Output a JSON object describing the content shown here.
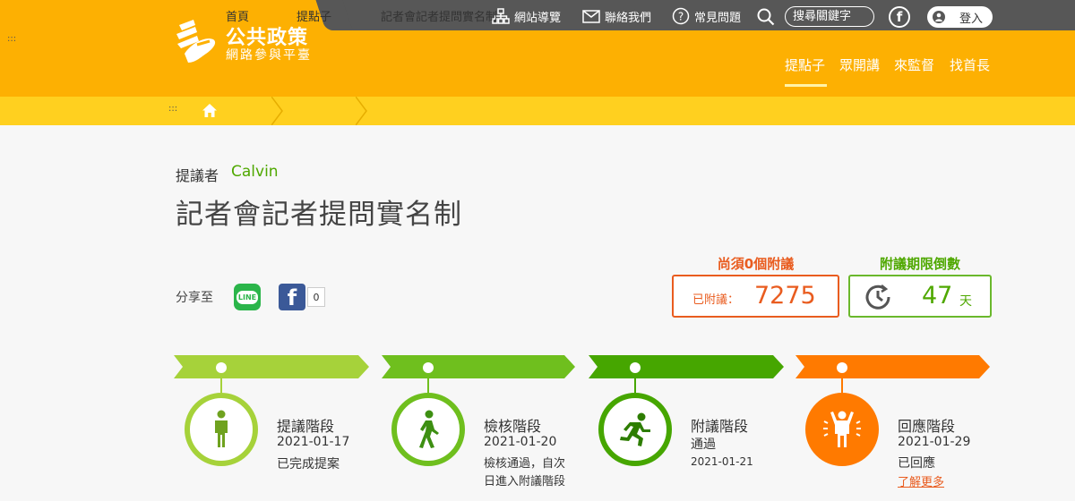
{
  "header": {
    "logo_title": "公共政策",
    "logo_subtitle": "網路參與平臺",
    "top_links": {
      "sitemap": "網站導覽",
      "contact": "聯絡我們",
      "faq": "常見問題"
    },
    "search_placeholder": "搜尋關鍵字",
    "facebook_glyph": "f",
    "login": "登入",
    "nav": [
      "提點子",
      "眾開講",
      "來監督",
      "找首長"
    ]
  },
  "breadcrumb": {
    "home": "首頁",
    "section": "提點子",
    "current": "記者會記者提問實名制"
  },
  "proposal": {
    "proposer_label": "提議者",
    "proposer_name": "Calvin",
    "title": "記者會記者提問實名制"
  },
  "share": {
    "label": "分享至",
    "line_text": "LINE",
    "facebook_glyph": "f",
    "facebook_count": "0"
  },
  "support": {
    "need_label": "尚須0個附議",
    "count_label": "已附議：",
    "count_value": "7275"
  },
  "countdown": {
    "label": "附議期限倒數",
    "value": "47",
    "unit": "天"
  },
  "stages": [
    {
      "name": "提議階段",
      "date": "2021-01-17",
      "note": "已完成提案",
      "color": "#a6d23a"
    },
    {
      "name": "檢核階段",
      "date": "2021-01-20",
      "note_lines": [
        "檢核通過，自次",
        "日進入附議階段"
      ],
      "color": "#6fbf1e"
    },
    {
      "name": "附議階段",
      "status": "通過",
      "date": "2021-01-21",
      "color": "#46a600"
    },
    {
      "name": "回應階段",
      "date": "2021-01-29",
      "note": "已回應",
      "link": "了解更多",
      "color": "#ff7a00"
    }
  ],
  "colors": {
    "header_bg": "#fdb002",
    "topbar_bg": "#575757",
    "breadcrumb_bg": "#ffd01f",
    "support_accent": "#e95c1f",
    "countdown_accent": "#4fa800"
  },
  "icons": [
    "sitemap-icon",
    "envelope-icon",
    "question-icon",
    "search-icon",
    "facebook-icon",
    "user-icon",
    "home-icon",
    "clock-icon",
    "line-icon"
  ]
}
